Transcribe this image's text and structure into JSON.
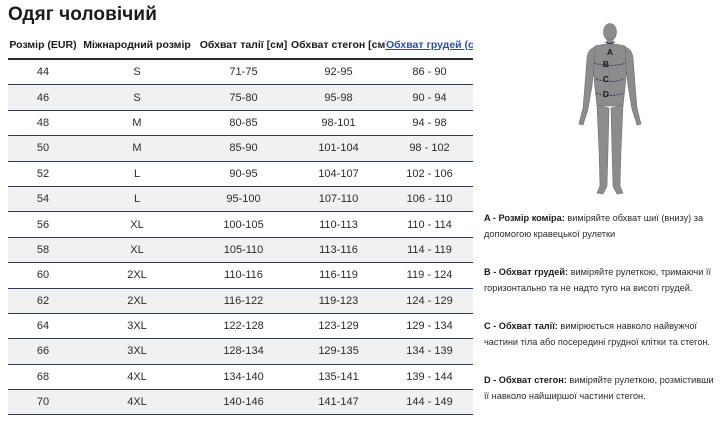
{
  "title": "Одяг чоловічий",
  "table": {
    "headers": [
      "Розмір (EUR)",
      "Міжнародний розмір",
      "Обхват талії [см]",
      "Обхват стегон [см]",
      "Обхват грудей (см)"
    ],
    "rows": [
      [
        "44",
        "S",
        "71-75",
        "92-95",
        "86 - 90"
      ],
      [
        "46",
        "S",
        "75-80",
        "95-98",
        "90 - 94"
      ],
      [
        "48",
        "M",
        "80-85",
        "98-101",
        "94 - 98"
      ],
      [
        "50",
        "M",
        "85-90",
        "101-104",
        "98 - 102"
      ],
      [
        "52",
        "L",
        "90-95",
        "104-107",
        "102 - 106"
      ],
      [
        "54",
        "L",
        "95-100",
        "107-110",
        "106 - 110"
      ],
      [
        "56",
        "XL",
        "100-105",
        "110-113",
        "110 - 114"
      ],
      [
        "58",
        "XL",
        "105-110",
        "113-116",
        "114 - 119"
      ],
      [
        "60",
        "2XL",
        "110-116",
        "116-119",
        "119 - 124"
      ],
      [
        "62",
        "2XL",
        "116-122",
        "119-123",
        "124 - 129"
      ],
      [
        "64",
        "3XL",
        "122-128",
        "123-129",
        "129 - 134"
      ],
      [
        "66",
        "3XL",
        "128-134",
        "129-135",
        "134 - 139"
      ],
      [
        "68",
        "4XL",
        "134-140",
        "135-141",
        "139 - 144"
      ],
      [
        "70",
        "4XL",
        "140-146",
        "141-147",
        "144 - 149"
      ]
    ]
  },
  "figure": {
    "labels": {
      "a": "A",
      "b": "B",
      "c": "C",
      "d": "D"
    }
  },
  "notes": [
    {
      "label": "A - Розмір коміра:",
      "text": " виміряйте обхват шиї (внизу) за допомогою кравецької рулетки"
    },
    {
      "label": "B - Обхват грудей:",
      "text": " виміряйте рулеткою, тримаючи її горизонтально та не надто туго на висоті грудей."
    },
    {
      "label": "C - Обхват талії:",
      "text": " вимірюється навколо найвужчої частини тіла або посередині грудної клітки та стегон."
    },
    {
      "label": "D - Обхват стегон:",
      "text": " виміряйте рулеткою, розмістивши її навколо найширшої частини стегон."
    }
  ],
  "colors": {
    "row_alt": "#f1f1f1",
    "row_border": "#2f3b55",
    "link": "#2a4fb0",
    "figure_body": "#8c8c8c"
  }
}
